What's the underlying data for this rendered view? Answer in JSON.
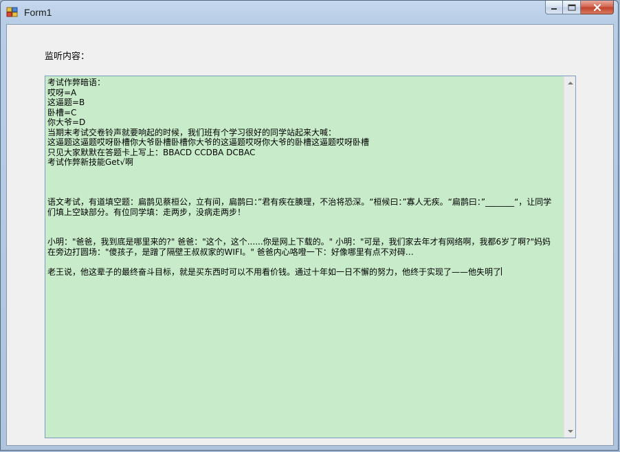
{
  "window": {
    "title": "Form1",
    "icon": "winforms-app-icon",
    "caption_buttons": [
      "minimize",
      "maximize",
      "close"
    ]
  },
  "form": {
    "label": "监听内容：",
    "textbox": {
      "background": "#c8ecca",
      "content": "考试作弊暗语：\n哎呀=A\n这逼题=B\n卧槽=C\n你大爷=D\n当期末考试交卷铃声就要响起的时候，我们班有个学习很好的同学站起来大喊：\n这逼题这逼题哎呀卧槽你大爷卧槽卧槽你大爷的这逼题哎呀你大爷的卧槽这逼题哎呀卧槽\n只见大家默默在答题卡上写上：BBACD CCDBA DCBAC\n考试作弊新技能Get√啊\n\n\n\n语文考试，有道填空题：扁鹊见蔡桓公，立有间，扁鹊曰：”君有疾在腠理，不治将恐深。“桓候曰：”寡人无疾。“扁鹊曰：”_______“，让同学们填上空缺部分。有位同学填：走两步，没病走两步！\n\n\n小明：\"爸爸，我到底是哪里来的?\" 爸爸：\"这个，这个......你是网上下载的。\" 小明：\"可是，我们家去年才有网络啊，我都6岁了啊?\"妈妈在旁边打圆场：\"傻孩子，是蹭了隔壁王叔叔家的WIFI。\" 爸爸内心咯噔一下：好像哪里有点不对碍…\n\n老王说，他这辈子的最终奋斗目标，就是买东西时可以不用看价钱。通过十年如一日不懈的努力，他终于实现了——他失明了"
    }
  }
}
